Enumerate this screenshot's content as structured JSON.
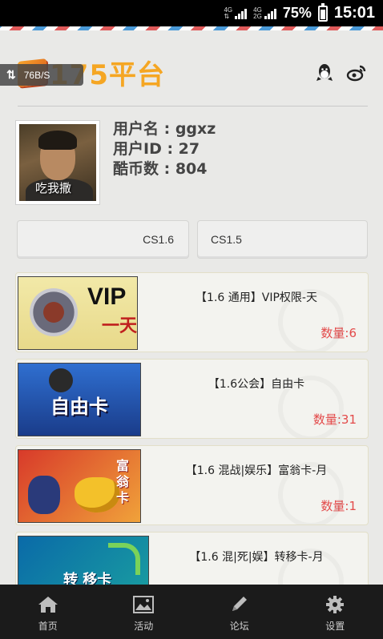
{
  "status_bar": {
    "network_top": "4G",
    "network_mid": "4G",
    "network_bottom": "2G",
    "battery_percent": "75%",
    "battery_level": 0.75,
    "time": "15:01"
  },
  "header": {
    "logo_text": "175平台",
    "speed_text": "76B/S",
    "icons": [
      "qq-icon",
      "weibo-icon"
    ]
  },
  "profile": {
    "avatar_caption": "吃我撒",
    "username_line": "用户名 : ggxz",
    "userid_line": "用户ID : 27",
    "coins_line": "酷币数 : 804"
  },
  "tabs": [
    {
      "label": "CS1.6"
    },
    {
      "label": "CS1.5"
    }
  ],
  "items": [
    {
      "thumb_text": "VIP",
      "thumb_sub": "一天",
      "title": "【1.6 通用】VIP权限-天",
      "count": "数量:6"
    },
    {
      "thumb_text": "自由卡",
      "title": "【1.6公会】自由卡",
      "count": "数量:31"
    },
    {
      "thumb_text": "富翁卡",
      "title": "【1.6 混战|娱乐】富翁卡-月",
      "count": "数量:1"
    },
    {
      "thumb_text": "转 移卡",
      "title": "【1.6 混|死|娱】转移卡-月",
      "count": ""
    }
  ],
  "bottom_nav": [
    {
      "label": "首页",
      "icon": "home-icon"
    },
    {
      "label": "活动",
      "icon": "image-icon"
    },
    {
      "label": "论坛",
      "icon": "pencil-icon"
    },
    {
      "label": "设置",
      "icon": "gear-icon"
    }
  ],
  "colors": {
    "accent": "#f5a623",
    "count_red": "#e34a4a",
    "nav_bg": "#1b1b1b"
  }
}
